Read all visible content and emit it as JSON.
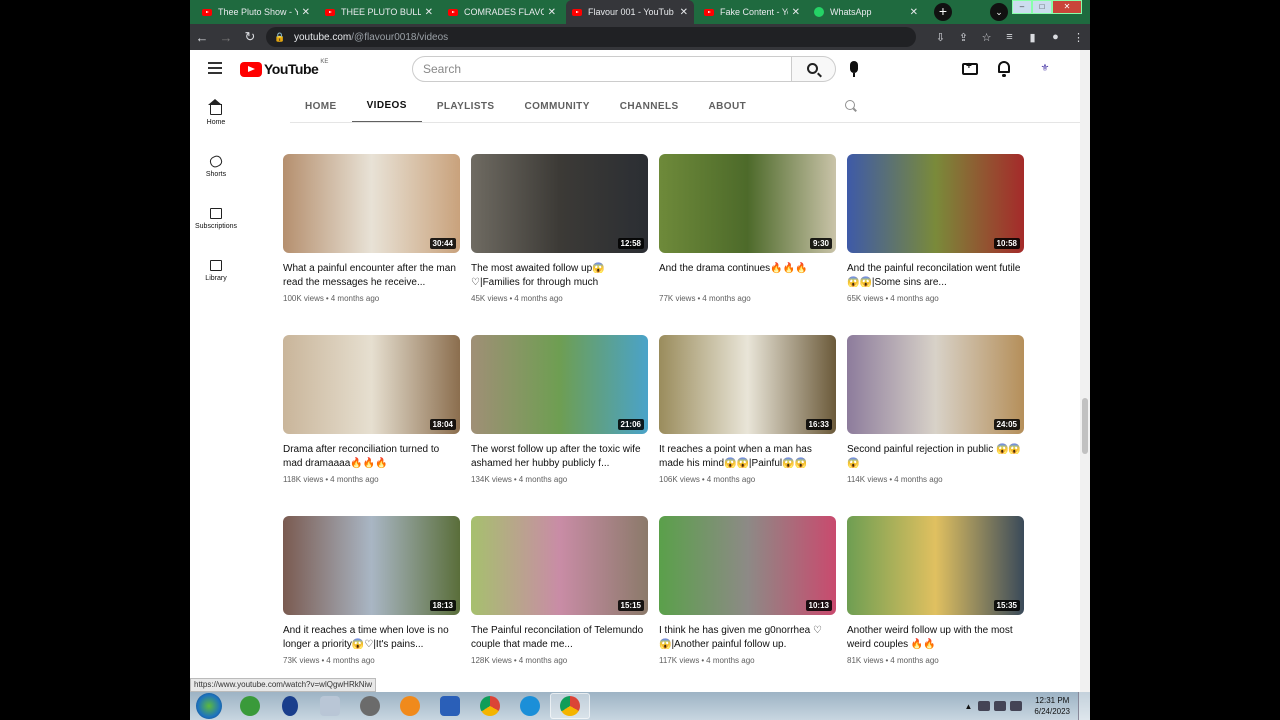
{
  "browser": {
    "tabs": [
      {
        "title": "Thee Pluto Show - Y",
        "icon": "youtube-icon"
      },
      {
        "title": "THEE PLUTO BULLET",
        "icon": "youtube-icon"
      },
      {
        "title": "COMRADES FLAVO",
        "icon": "youtube-icon"
      },
      {
        "title": "Flavour 001 - YouTub",
        "icon": "youtube-icon",
        "active": true
      },
      {
        "title": "Fake Content - YouT",
        "icon": "youtube-icon"
      },
      {
        "title": "WhatsApp",
        "icon": "whatsapp-icon"
      }
    ],
    "url_host": "youtube.com",
    "url_path": "/@flavour0018/videos",
    "status_url": "https://www.youtube.com/watch?v=wlQgwHRkNiw"
  },
  "youtube": {
    "logo_text": "YouTube",
    "country_code": "KE",
    "search_placeholder": "Search",
    "sidenav": [
      {
        "label": "Home",
        "icon": "home-icon"
      },
      {
        "label": "Shorts",
        "icon": "shorts-icon"
      },
      {
        "label": "Subscriptions",
        "icon": "subscriptions-icon"
      },
      {
        "label": "Library",
        "icon": "library-icon"
      }
    ],
    "channel_tabs": [
      "HOME",
      "VIDEOS",
      "PLAYLISTS",
      "COMMUNITY",
      "CHANNELS",
      "ABOUT"
    ],
    "selected_tab": "VIDEOS"
  },
  "videos": [
    {
      "title": "What a painful encounter after the man read the messages he receive...",
      "views": "100K views",
      "age": "4 months ago",
      "duration": "30:44"
    },
    {
      "title": "The most awaited follow up😱 ♡|Families for through much",
      "views": "45K views",
      "age": "4 months ago",
      "duration": "12:58"
    },
    {
      "title": "And the drama continues🔥🔥🔥",
      "views": "77K views",
      "age": "4 months ago",
      "duration": "9:30"
    },
    {
      "title": "And the painful reconcilation went futile😱😱|Some sins are...",
      "views": "65K views",
      "age": "4 months ago",
      "duration": "10:58"
    },
    {
      "title": "Drama after reconciliation turned to mad dramaaaa🔥🔥🔥",
      "views": "118K views",
      "age": "4 months ago",
      "duration": "18:04"
    },
    {
      "title": "The worst follow up after the toxic wife ashamed her hubby publicly f...",
      "views": "134K views",
      "age": "4 months ago",
      "duration": "21:06"
    },
    {
      "title": "It reaches a point when a man has made his mind😱😱|Painful😱😱",
      "views": "106K views",
      "age": "4 months ago",
      "duration": "16:33"
    },
    {
      "title": "Second painful rejection in public 😱😱😱",
      "views": "114K views",
      "age": "4 months ago",
      "duration": "24:05"
    },
    {
      "title": "And it reaches a time when love is no longer a priority😱♡|It's pains...",
      "views": "73K views",
      "age": "4 months ago",
      "duration": "18:13"
    },
    {
      "title": "The Painful reconcilation of Telemundo couple that made me...",
      "views": "128K views",
      "age": "4 months ago",
      "duration": "15:15"
    },
    {
      "title": "I think he has given me g0norrhea ♡😱|Another painful follow up.",
      "views": "117K views",
      "age": "4 months ago",
      "duration": "10:13"
    },
    {
      "title": "Another weird follow up with the most weird couples 🔥🔥",
      "views": "81K views",
      "age": "4 months ago",
      "duration": "15:35"
    }
  ],
  "taskbar": {
    "time": "12:31 PM",
    "date": "6/24/2023"
  }
}
